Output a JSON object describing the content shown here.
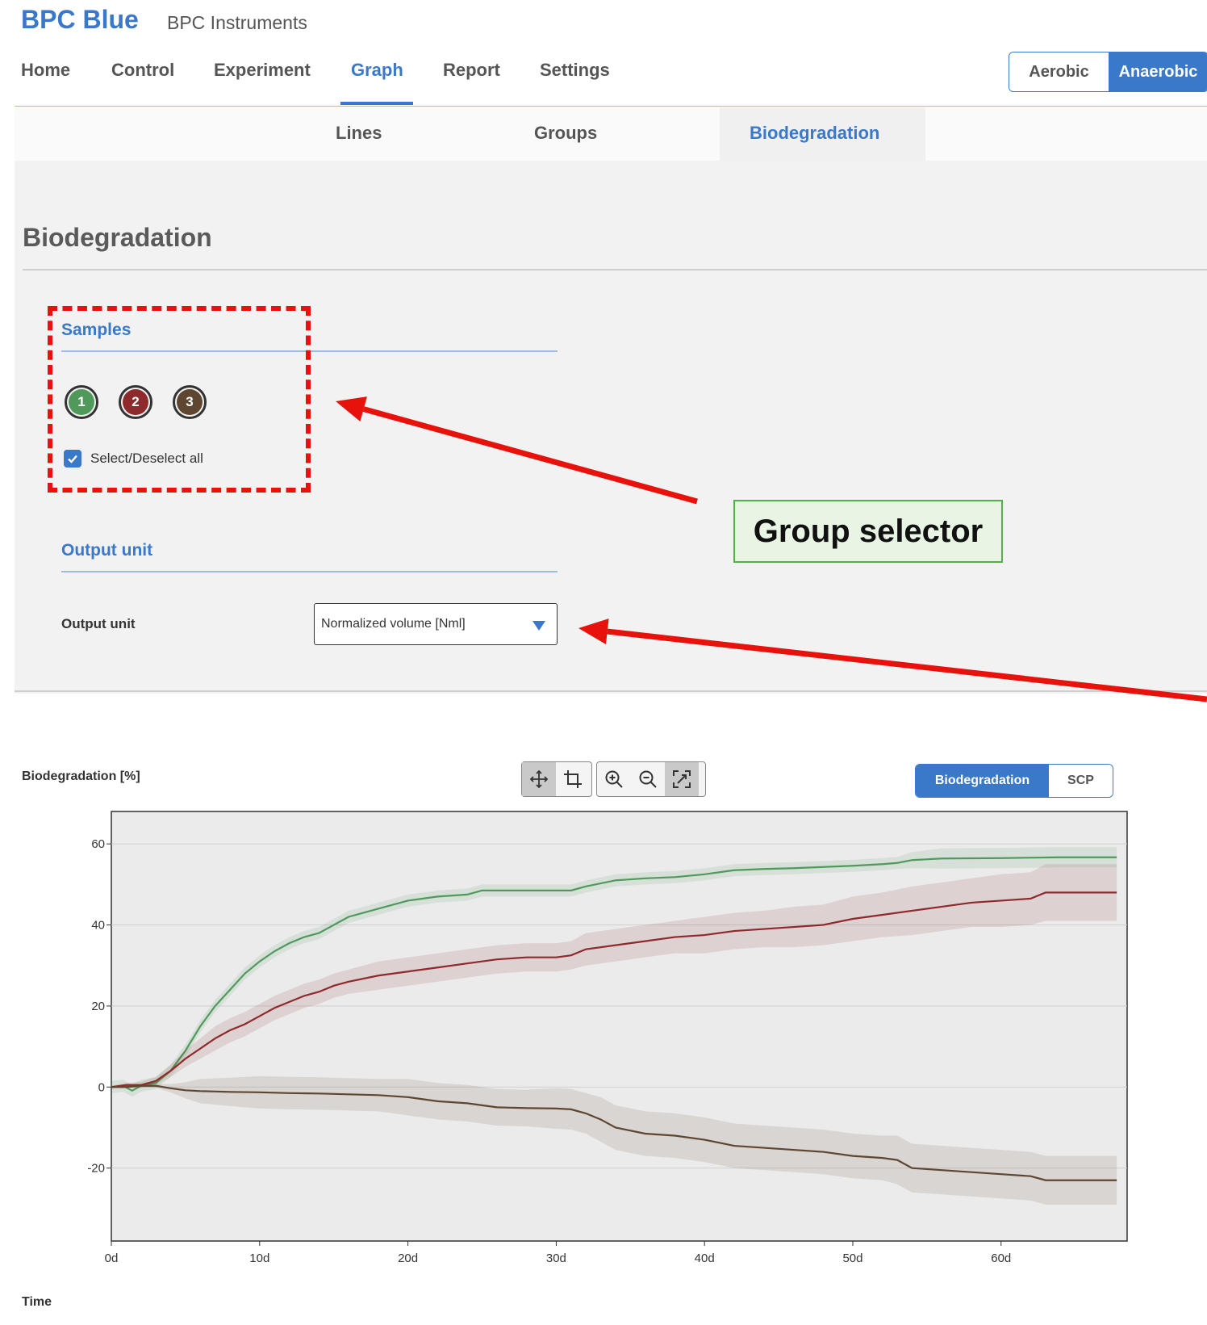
{
  "app": {
    "brand": "BPC Blue",
    "company": "BPC Instruments"
  },
  "topnav": {
    "items": [
      {
        "label": "Home",
        "active": false
      },
      {
        "label": "Control",
        "active": false
      },
      {
        "label": "Experiment",
        "active": false
      },
      {
        "label": "Graph",
        "active": true
      },
      {
        "label": "Report",
        "active": false
      },
      {
        "label": "Settings",
        "active": false
      }
    ]
  },
  "mode_toggle": {
    "options": [
      "Aerobic",
      "Anaerobic"
    ],
    "selected": "Anaerobic"
  },
  "subnav": {
    "items": [
      {
        "label": "Lines",
        "active": false
      },
      {
        "label": "Groups",
        "active": false
      },
      {
        "label": "Biodegradation",
        "active": true
      }
    ]
  },
  "page": {
    "title": "Biodegradation",
    "samples": {
      "title": "Samples",
      "items": [
        {
          "label": "1",
          "color": "#4f9a5b"
        },
        {
          "label": "2",
          "color": "#8e2a2c"
        },
        {
          "label": "3",
          "color": "#5e4630"
        }
      ],
      "select_all_label": "Select/Deselect all",
      "select_all_checked": true
    },
    "output": {
      "title": "Output unit",
      "field_label": "Output unit",
      "selected": "Normalized volume [Nml]"
    }
  },
  "annotation": {
    "callout": "Group selector",
    "color": "#e8120c"
  },
  "chart_toolbar": {
    "icons": [
      "pan-icon",
      "crop-icon",
      "zoom-in-icon",
      "zoom-out-icon",
      "reset-zoom-icon"
    ],
    "toggle_options": [
      "Biodegradation",
      "SCP"
    ],
    "toggle_selected": "Biodegradation"
  },
  "chart_data": {
    "type": "line",
    "ylabel": "Biodegradation [%]",
    "xlabel": "Time",
    "xlim": [
      0,
      68.5
    ],
    "ylim": [
      -38,
      68
    ],
    "xticks": [
      0,
      10,
      20,
      30,
      40,
      50,
      60
    ],
    "xtick_labels": [
      "0d",
      "10d",
      "20d",
      "30d",
      "40d",
      "50d",
      "60d"
    ],
    "yticks": [
      60,
      40,
      20,
      0,
      -20
    ],
    "ytick_labels": [
      "60",
      "40",
      "20",
      "0",
      "-20"
    ],
    "grid": true,
    "series": [
      {
        "color": "#4f9a5b",
        "x": [
          0,
          0.8,
          1.4,
          2,
          3,
          4,
          5,
          6,
          7,
          8,
          9,
          10,
          11,
          12,
          13,
          14,
          15,
          16,
          18,
          20,
          22,
          24,
          25,
          28,
          30,
          31,
          32,
          34,
          36,
          38,
          40,
          42,
          44,
          46,
          48,
          50,
          52,
          53,
          54,
          56,
          60,
          64,
          67.8
        ],
        "y": [
          0,
          0.3,
          -0.9,
          0.3,
          1,
          4,
          9,
          15,
          20,
          24,
          28,
          31,
          33.5,
          35.5,
          37,
          38,
          40,
          42,
          44,
          46,
          47,
          47.5,
          48.5,
          48.5,
          48.5,
          48.5,
          49.5,
          51,
          51.5,
          51.8,
          52.5,
          53.5,
          53.8,
          54,
          54.3,
          54.6,
          55,
          55.3,
          56,
          56.4,
          56.5,
          56.7,
          56.7
        ],
        "band": [
          1.5,
          1.5,
          1.5,
          1.5,
          1.5,
          1.5,
          1.5,
          1.5,
          1.5,
          1.5,
          1.5,
          1.5,
          1.5,
          1.5,
          1.5,
          1.5,
          1.5,
          1.5,
          1.5,
          1.5,
          1.5,
          1.5,
          1.5,
          1.5,
          1.5,
          1.5,
          1.5,
          1.5,
          1.5,
          1.5,
          1.5,
          1.5,
          1.5,
          1.5,
          1.5,
          1.5,
          1.5,
          1.5,
          2,
          2.5,
          2.5,
          2.5,
          2.5
        ]
      },
      {
        "color": "#8e2a2c",
        "x": [
          0,
          1,
          2,
          3,
          4,
          5,
          6,
          7,
          8,
          9,
          10,
          11,
          12,
          13,
          14,
          15,
          16,
          18,
          20,
          22,
          24,
          26,
          28,
          30,
          31,
          32,
          34,
          36,
          38,
          40,
          42,
          44,
          46,
          48,
          50,
          52,
          54,
          56,
          58,
          60,
          62,
          63,
          67.8
        ],
        "y": [
          0,
          0.5,
          0.5,
          1.5,
          4,
          7,
          9.5,
          12,
          14,
          15.5,
          17.5,
          19.5,
          21,
          22.5,
          23.5,
          25,
          26,
          27.5,
          28.5,
          29.5,
          30.5,
          31.5,
          32,
          32,
          32.5,
          34,
          35,
          36,
          37,
          37.5,
          38.5,
          39,
          39.5,
          40,
          41.5,
          42.5,
          43.5,
          44.5,
          45.5,
          46,
          46.5,
          48,
          48
        ],
        "band": [
          0.3,
          0.5,
          0.8,
          1,
          1.5,
          2,
          2.5,
          3,
          3,
          3,
          3,
          3,
          3,
          3,
          3,
          3,
          3,
          3.5,
          3.5,
          3.5,
          3.5,
          3.5,
          3.5,
          3.5,
          3.5,
          4,
          4,
          4,
          4,
          4.5,
          4.5,
          4.5,
          5,
          5,
          5.5,
          5.5,
          6,
          6,
          6,
          6.5,
          6.5,
          7,
          7
        ]
      },
      {
        "color": "#5e4630",
        "x": [
          0,
          1,
          2,
          3,
          4,
          5,
          6,
          8,
          10,
          12,
          14,
          16,
          18,
          20,
          22,
          24,
          26,
          28,
          30,
          31,
          32,
          33,
          34,
          36,
          38,
          40,
          42,
          44,
          46,
          48,
          50,
          52,
          53,
          54,
          56,
          58,
          60,
          62,
          63,
          67.8
        ],
        "y": [
          0,
          0,
          0.3,
          0.3,
          -0.3,
          -0.8,
          -1,
          -1.2,
          -1.3,
          -1.5,
          -1.6,
          -1.8,
          -2,
          -2.5,
          -3.5,
          -4,
          -5,
          -5.2,
          -5.3,
          -5.5,
          -6.5,
          -8,
          -10,
          -11.5,
          -12,
          -13,
          -14.5,
          -15,
          -15.5,
          -16,
          -17,
          -17.5,
          -18,
          -20,
          -20.5,
          -21,
          -21.5,
          -22,
          -23,
          -23
        ],
        "band": [
          0.3,
          0.3,
          0.3,
          0.5,
          1,
          2,
          3,
          3.5,
          4,
          4,
          4,
          4,
          4,
          4.5,
          4.5,
          4.5,
          4.5,
          4.5,
          5,
          5,
          5,
          5.5,
          5.5,
          5.5,
          5.5,
          5.5,
          5.5,
          5.5,
          5.5,
          5.5,
          5.5,
          5.5,
          6,
          6,
          6,
          6,
          6,
          6,
          6,
          6
        ]
      }
    ]
  }
}
